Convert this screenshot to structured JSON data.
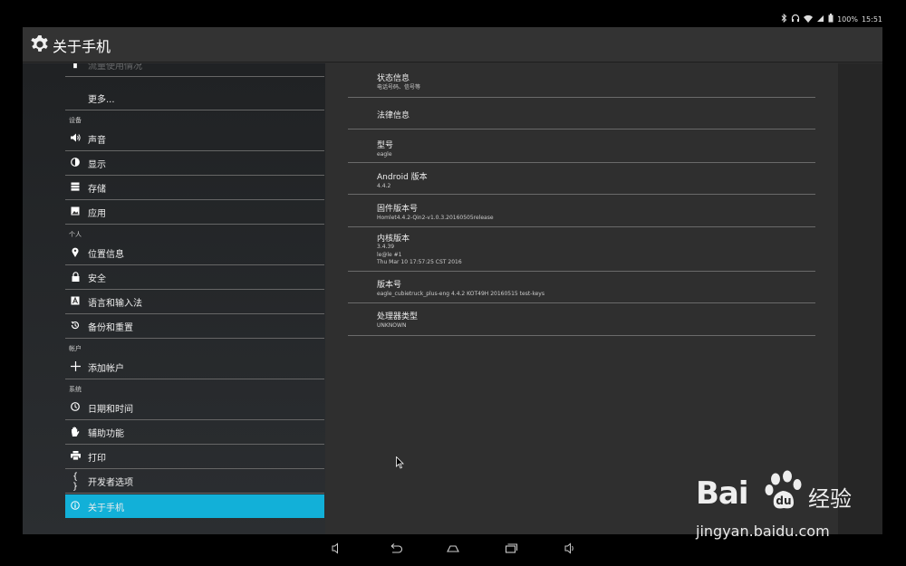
{
  "statusbar": {
    "battery": "100%",
    "time": "15:51"
  },
  "actionbar": {
    "title": "关于手机"
  },
  "sidebar": {
    "partial_top_label": "流量使用情况",
    "more": "更多...",
    "sections": {
      "device": "设备",
      "personal": "个人",
      "accounts": "帐户",
      "system": "系统"
    },
    "items": [
      {
        "label": "声音",
        "icon": "volume-icon"
      },
      {
        "label": "显示",
        "icon": "display-icon"
      },
      {
        "label": "存储",
        "icon": "storage-icon"
      },
      {
        "label": "应用",
        "icon": "apps-icon"
      },
      {
        "label": "位置信息",
        "icon": "location-icon"
      },
      {
        "label": "安全",
        "icon": "lock-icon"
      },
      {
        "label": "语言和输入法",
        "icon": "language-icon"
      },
      {
        "label": "备份和重置",
        "icon": "backup-icon"
      },
      {
        "label": "添加帐户",
        "icon": "plus-icon"
      },
      {
        "label": "日期和时间",
        "icon": "clock-icon"
      },
      {
        "label": "辅助功能",
        "icon": "hand-icon"
      },
      {
        "label": "打印",
        "icon": "printer-icon"
      },
      {
        "label": "开发者选项",
        "icon": "braces-icon"
      },
      {
        "label": "关于手机",
        "icon": "info-icon",
        "selected": true
      }
    ]
  },
  "details": [
    {
      "title": "状态信息",
      "subtitle": "电话号码、信号等"
    },
    {
      "title": "法律信息"
    },
    {
      "title": "型号",
      "subtitle": "eagle"
    },
    {
      "title": "Android 版本",
      "subtitle": "4.4.2"
    },
    {
      "title": "固件版本号",
      "subtitle": "Homlet4.4.2-Qin2-v1.0.3.20160505release"
    },
    {
      "title": "内核版本",
      "line1": "3.4.39",
      "line2": "le@le #1",
      "line3": "Thu Mar 10 17:57:25 CST 2016"
    },
    {
      "title": "版本号",
      "subtitle": "eagle_cubietruck_plus-eng 4.4.2 KOT49H 20160515 test-keys"
    },
    {
      "title": "处理器类型",
      "subtitle": "UNKNOWN"
    }
  ],
  "watermark": {
    "logo": "Bai",
    "logo_cn": "经验",
    "url": "jingyan.baidu.com"
  },
  "colors": {
    "accent": "#12b0d8",
    "background": "#2f2f2f",
    "divider": "#6a6a6a"
  }
}
